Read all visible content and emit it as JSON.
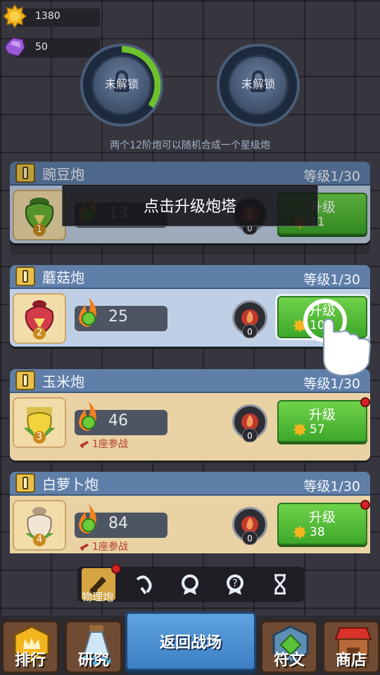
{
  "resources": {
    "gold": "1380",
    "gems": "50"
  },
  "slots": [
    {
      "label": "未解锁",
      "progress": 0.35
    },
    {
      "label": "未解锁",
      "progress": 0
    }
  ],
  "merge_hint": "两个12阶炮可以随机合成一个星级炮",
  "toast": "点击升级炮塔",
  "towers": [
    {
      "name": "豌豆炮",
      "level": "等级1/30",
      "badge": "1",
      "power": "13",
      "gems": "0",
      "upgrade_label": "升级",
      "cost": "11",
      "deployed": "",
      "alert": false
    },
    {
      "name": "蘑菇炮",
      "level": "等级1/30",
      "badge": "2",
      "power": "25",
      "gems": "0",
      "upgrade_label": "升级",
      "cost": "10",
      "deployed": "",
      "alert": false
    },
    {
      "name": "玉米炮",
      "level": "等级1/30",
      "badge": "3",
      "power": "46",
      "gems": "0",
      "upgrade_label": "升级",
      "cost": "57",
      "deployed": "1座参战",
      "alert": true
    },
    {
      "name": "白萝卜炮",
      "level": "等级1/30",
      "badge": "4",
      "power": "84",
      "gems": "0",
      "upgrade_label": "升级",
      "cost": "38",
      "deployed": "1座参战",
      "alert": true
    }
  ],
  "category_tabs": {
    "active_label": "物理炮"
  },
  "bottom_nav": {
    "rank": "排行",
    "research": "研究",
    "battle": "返回战场",
    "runes": "符文",
    "shop": "商店"
  },
  "colors": {
    "upgrade_green": "#4fbb36",
    "header_blue": "#5f7fa9",
    "alert_red": "#d8222a"
  }
}
